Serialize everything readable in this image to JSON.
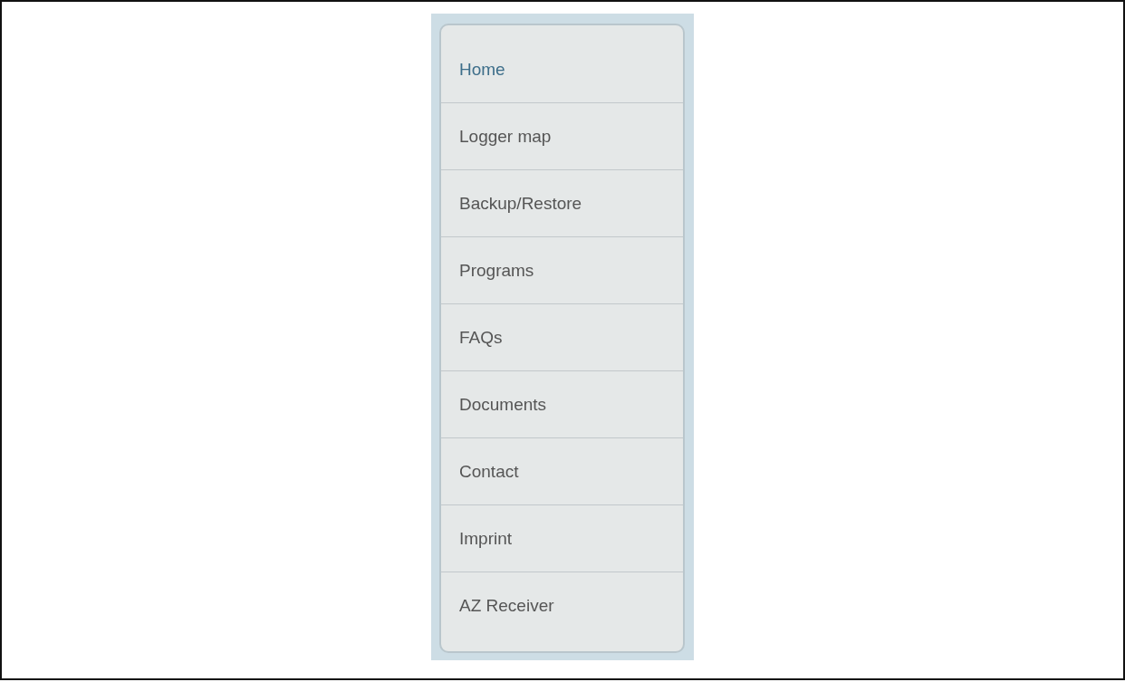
{
  "menu": {
    "items": [
      {
        "label": "Home",
        "selected": true
      },
      {
        "label": "Logger map",
        "selected": false
      },
      {
        "label": "Backup/Restore",
        "selected": false
      },
      {
        "label": "Programs",
        "selected": false
      },
      {
        "label": "FAQs",
        "selected": false
      },
      {
        "label": "Documents",
        "selected": false
      },
      {
        "label": "Contact",
        "selected": false
      },
      {
        "label": "Imprint",
        "selected": false
      },
      {
        "label": "AZ Receiver",
        "selected": false
      }
    ]
  }
}
